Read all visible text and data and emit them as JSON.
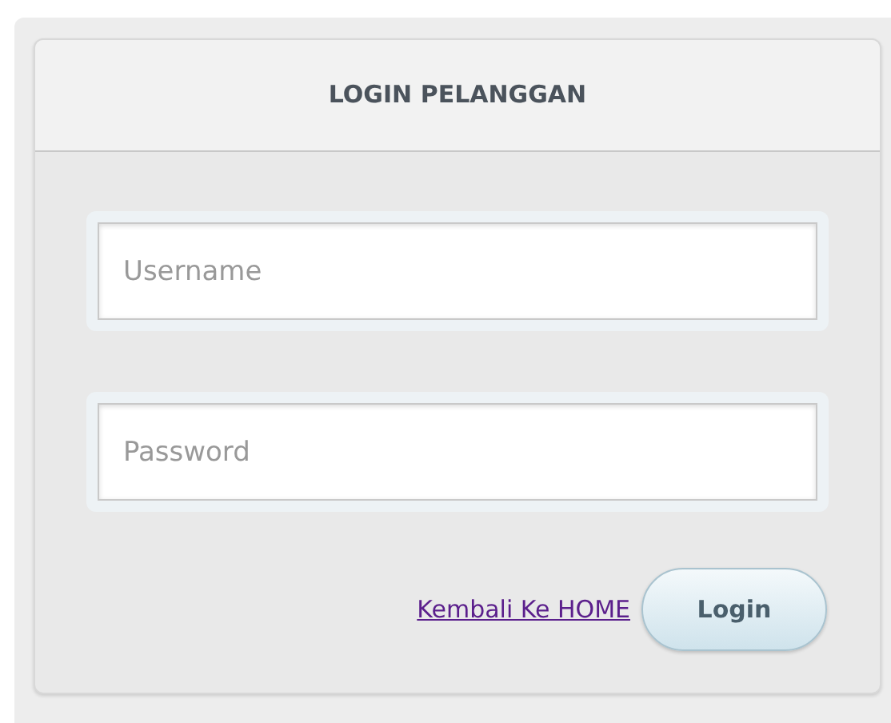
{
  "panel": {
    "title": "LOGIN PELANGGAN"
  },
  "fields": [
    {
      "placeholder": "Username"
    },
    {
      "placeholder": "Password"
    }
  ],
  "link": "Kembali Ke HOME",
  "button": "Login"
}
